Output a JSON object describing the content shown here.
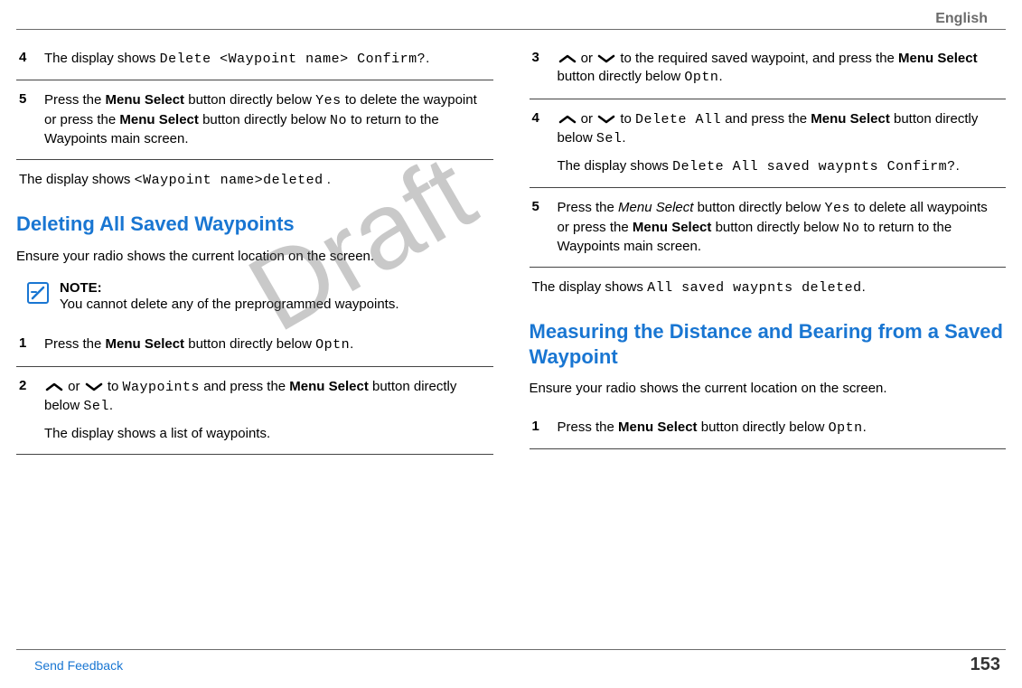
{
  "header": {
    "lang": "English"
  },
  "watermark": "Draft",
  "left": {
    "step4": {
      "num": "4",
      "pre": "The display shows ",
      "code": "Delete <Waypoint name> Confirm?",
      "post": "."
    },
    "step5": {
      "num": "5",
      "t1": "Press the ",
      "b1": "Menu Select",
      "t2": " button directly below ",
      "c1": "Yes",
      "t3": " to delete the waypoint or press the ",
      "b2": "Menu Select",
      "t4": " button directly below ",
      "c2": "No",
      "t5": " to return to the Waypoints main screen."
    },
    "after5": {
      "t1": "The display shows ",
      "c1": "<Waypoint name>deleted",
      "t2": " ."
    },
    "heading1": "Deleting All Saved Waypoints",
    "intro1": "Ensure your radio shows the current location on the screen.",
    "note": {
      "label": "NOTE:",
      "text": "You cannot delete any of the preprogrammed waypoints."
    },
    "step1": {
      "num": "1",
      "t1": "Press the ",
      "b1": "Menu Select",
      "t2": " button directly below ",
      "c1": "Optn",
      "t3": "."
    },
    "step2": {
      "num": "2",
      "t1": " or ",
      "t2": " to ",
      "c1": "Waypoints",
      "t3": " and press the ",
      "b1": "Menu Select",
      "t4": " button directly below ",
      "c2": "Sel",
      "t5": ".",
      "p2": "The display shows a list of waypoints."
    }
  },
  "right": {
    "step3": {
      "num": "3",
      "t1": " or ",
      "t2": " to the required saved waypoint, and press the ",
      "b1": "Menu Select",
      "t3": " button directly below ",
      "c1": "Optn",
      "t4": "."
    },
    "step4": {
      "num": "4",
      "t1": " or ",
      "t2": " to ",
      "c1": "Delete All",
      "t3": " and press the ",
      "b1": "Menu Select",
      "t4": " button directly below ",
      "c2": "Sel",
      "t5": ".",
      "p2a": "The display shows ",
      "p2c": "Delete All saved waypnts Confirm?",
      "p2b": "."
    },
    "step5": {
      "num": "5",
      "t1": "Press the ",
      "i1": "Menu Select",
      "t2": " button directly below ",
      "c1": "Yes",
      "t3": " to delete all waypoints or press the ",
      "b1": "Menu Select",
      "t4": " button directly below ",
      "c2": "No",
      "t5": " to return to the Waypoints main screen."
    },
    "after5": {
      "t1": "The display shows ",
      "c1": "All saved waypnts deleted",
      "t2": "."
    },
    "heading2": "Measuring the Distance and Bearing from a Saved Waypoint",
    "intro2": "Ensure your radio shows the current location on the screen.",
    "step1b": {
      "num": "1",
      "t1": "Press the ",
      "b1": "Menu Select",
      "t2": " button directly below ",
      "c1": "Optn",
      "t3": "."
    }
  },
  "footer": {
    "send": "Send Feedback",
    "page": "153"
  }
}
